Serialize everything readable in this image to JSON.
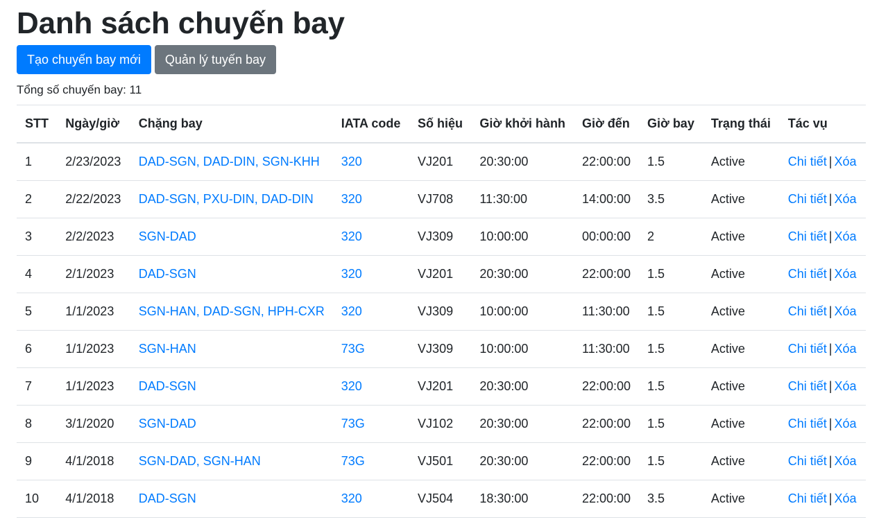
{
  "page": {
    "title": "Danh sách chuyến bay",
    "create_button": "Tạo chuyến bay mới",
    "manage_routes_button": "Quản lý tuyến bay",
    "total_text": "Tổng số chuyến bay: 11"
  },
  "colors": {
    "primary": "#007bff",
    "secondary": "#6c757d",
    "link": "#007bff",
    "border": "#dee2e6"
  },
  "table": {
    "headers": [
      "STT",
      "Ngày/giờ",
      "Chặng bay",
      "IATA code",
      "Số hiệu",
      "Giờ khởi hành",
      "Giờ đến",
      "Giờ bay",
      "Trạng thái",
      "Tác vụ"
    ],
    "detail_label": "Chi tiết",
    "separator": "|",
    "delete_label": "Xóa",
    "rows": [
      {
        "stt": "1",
        "date": "2/23/2023",
        "route": "DAD-SGN, DAD-DIN, SGN-KHH",
        "iata": "320",
        "flight": "VJ201",
        "departure": "20:30:00",
        "arrival": "22:00:00",
        "duration": "1.5",
        "status": "Active"
      },
      {
        "stt": "2",
        "date": "2/22/2023",
        "route": "DAD-SGN, PXU-DIN, DAD-DIN",
        "iata": "320",
        "flight": "VJ708",
        "departure": "11:30:00",
        "arrival": "14:00:00",
        "duration": "3.5",
        "status": "Active"
      },
      {
        "stt": "3",
        "date": "2/2/2023",
        "route": "SGN-DAD",
        "iata": "320",
        "flight": "VJ309",
        "departure": "10:00:00",
        "arrival": "00:00:00",
        "duration": "2",
        "status": "Active"
      },
      {
        "stt": "4",
        "date": "2/1/2023",
        "route": "DAD-SGN",
        "iata": "320",
        "flight": "VJ201",
        "departure": "20:30:00",
        "arrival": "22:00:00",
        "duration": "1.5",
        "status": "Active"
      },
      {
        "stt": "5",
        "date": "1/1/2023",
        "route": "SGN-HAN, DAD-SGN, HPH-CXR",
        "iata": "320",
        "flight": "VJ309",
        "departure": "10:00:00",
        "arrival": "11:30:00",
        "duration": "1.5",
        "status": "Active"
      },
      {
        "stt": "6",
        "date": "1/1/2023",
        "route": "SGN-HAN",
        "iata": "73G",
        "flight": "VJ309",
        "departure": "10:00:00",
        "arrival": "11:30:00",
        "duration": "1.5",
        "status": "Active"
      },
      {
        "stt": "7",
        "date": "1/1/2023",
        "route": "DAD-SGN",
        "iata": "320",
        "flight": "VJ201",
        "departure": "20:30:00",
        "arrival": "22:00:00",
        "duration": "1.5",
        "status": "Active"
      },
      {
        "stt": "8",
        "date": "3/1/2020",
        "route": "SGN-DAD",
        "iata": "73G",
        "flight": "VJ102",
        "departure": "20:30:00",
        "arrival": "22:00:00",
        "duration": "1.5",
        "status": "Active"
      },
      {
        "stt": "9",
        "date": "4/1/2018",
        "route": "SGN-DAD, SGN-HAN",
        "iata": "73G",
        "flight": "VJ501",
        "departure": "20:30:00",
        "arrival": "22:00:00",
        "duration": "1.5",
        "status": "Active"
      },
      {
        "stt": "10",
        "date": "4/1/2018",
        "route": "DAD-SGN",
        "iata": "320",
        "flight": "VJ504",
        "departure": "18:30:00",
        "arrival": "22:00:00",
        "duration": "3.5",
        "status": "Active"
      }
    ]
  }
}
